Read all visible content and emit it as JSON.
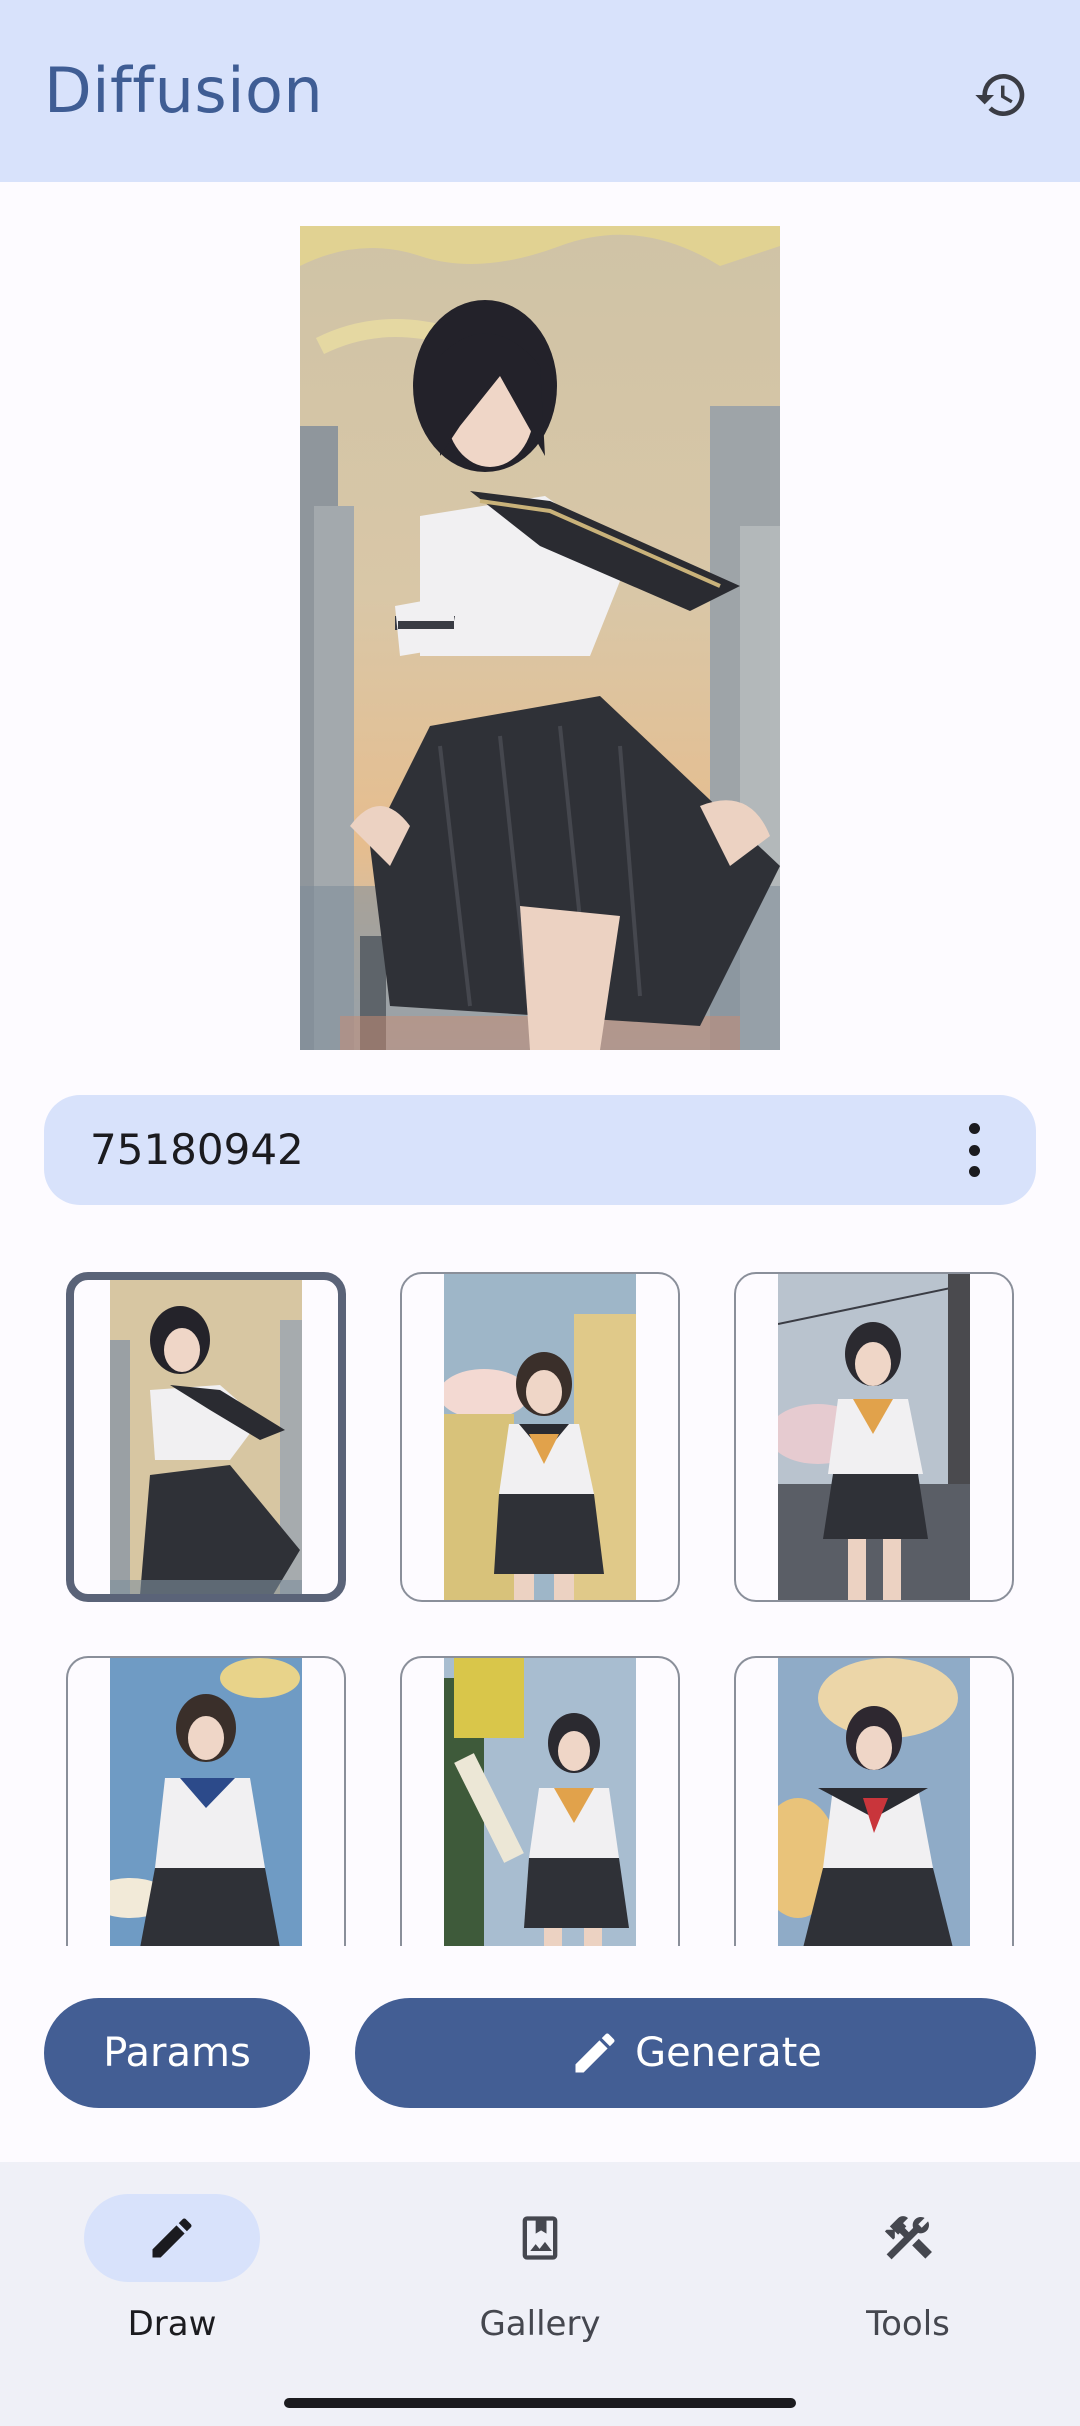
{
  "app": {
    "title": "Diffusion"
  },
  "seed": {
    "value": "75180942"
  },
  "actions": {
    "params_label": "Params",
    "generate_label": "Generate"
  },
  "nav": {
    "items": [
      {
        "label": "Draw",
        "icon": "pencil-icon",
        "active": true
      },
      {
        "label": "Gallery",
        "icon": "gallery-icon",
        "active": false
      },
      {
        "label": "Tools",
        "icon": "tools-icon",
        "active": false
      }
    ]
  },
  "thumbnails": {
    "count": 6,
    "selected_index": 0
  },
  "colors": {
    "accent": "#435e94",
    "topbar": "#d8e2fb",
    "title": "#3f5d94",
    "background": "#fdfbff",
    "navbar": "#eff0f7"
  }
}
